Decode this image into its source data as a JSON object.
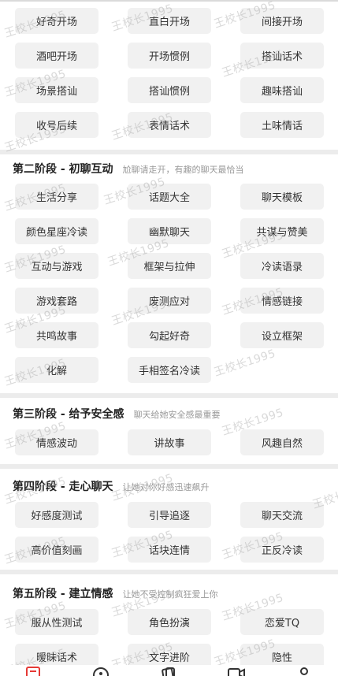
{
  "sections": [
    {
      "title": "",
      "desc": "",
      "items": [
        "好奇开场",
        "直白开场",
        "间接开场",
        "酒吧开场",
        "开场惯例",
        "搭讪话术",
        "场景搭讪",
        "搭讪惯例",
        "趣味搭讪",
        "收号后续",
        "表情话术",
        "土味情话"
      ]
    },
    {
      "title": "第二阶段 - 初聊互动",
      "desc": "尬聊请走开，有趣的聊天最恰当",
      "items": [
        "生活分享",
        "话题大全",
        "聊天模板",
        "颜色星座冷读",
        "幽默聊天",
        "共谋与赞美",
        "互动与游戏",
        "框架与拉伸",
        "冷读语录",
        "游戏套路",
        "废测应对",
        "情感链接",
        "共鸣故事",
        "勾起好奇",
        "设立框架",
        "化解",
        "手相签名冷读"
      ]
    },
    {
      "title": "第三阶段 - 给予安全感",
      "desc": "聊天给她安全感最重要",
      "items": [
        "情感波动",
        "讲故事",
        "风趣自然"
      ]
    },
    {
      "title": "第四阶段 - 走心聊天",
      "desc": "让她对你好感迅速飙升",
      "items": [
        "好感度测试",
        "引导追逐",
        "聊天交流",
        "高价值刻画",
        "话块连情",
        "正反冷读"
      ]
    },
    {
      "title": "第五阶段 - 建立情感",
      "desc": "让她不受控制疯狂爱上你",
      "items": [
        "服从性测试",
        "角色扮演",
        "恋爱TQ",
        "暧昧话术",
        "文字进阶",
        "隐性"
      ]
    }
  ],
  "watermark": "王校长1995",
  "tabbar": {
    "icons": [
      "document-icon",
      "compass-icon",
      "cards-icon",
      "video-icon",
      "profile-icon"
    ],
    "active_color": "#e53935"
  }
}
